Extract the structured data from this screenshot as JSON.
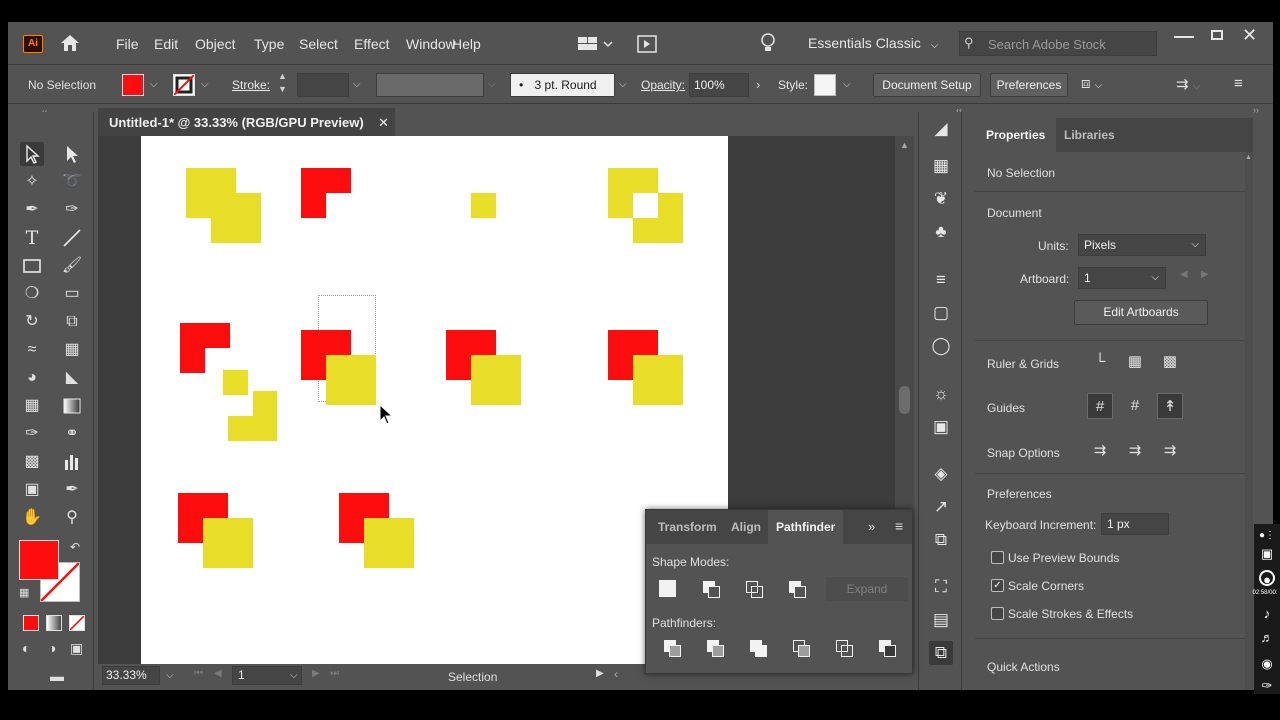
{
  "menu": {
    "logo": "Ai",
    "items": [
      "File",
      "Edit",
      "Object",
      "Type",
      "Select",
      "Effect",
      "Window",
      "Help"
    ],
    "workspace": "Essentials Classic",
    "search_placeholder": "Search Adobe Stock"
  },
  "control": {
    "selection_label": "No Selection",
    "fill_color": "#fd0d0d",
    "stroke_label": "Stroke:",
    "brush_label": "3 pt. Round",
    "opacity_label": "Opacity:",
    "opacity_value": "100%",
    "style_label": "Style:",
    "document_setup": "Document Setup",
    "preferences": "Preferences"
  },
  "document": {
    "tab_title": "Untitled-1* @ 33.33% (RGB/GPU Preview)",
    "zoom": "33.33%",
    "artboard_num": "1",
    "status_tool": "Selection"
  },
  "shape_colors": {
    "red": "#fd0d0d",
    "yellow": "#e9de27"
  },
  "pathfinder": {
    "tabs": [
      "Transform",
      "Align",
      "Pathfinder"
    ],
    "active_tab": "Pathfinder",
    "shape_modes_label": "Shape Modes:",
    "expand_label": "Expand",
    "pathfinders_label": "Pathfinders:"
  },
  "properties": {
    "tabs": [
      "Properties",
      "Libraries"
    ],
    "active_tab": "Properties",
    "no_selection": "No Selection",
    "document_label": "Document",
    "units_label": "Units:",
    "units_value": "Pixels",
    "artboard_label": "Artboard:",
    "artboard_value": "1",
    "edit_artboards": "Edit Artboards",
    "ruler_grids": "Ruler & Grids",
    "guides": "Guides",
    "snap_options": "Snap Options",
    "preferences_label": "Preferences",
    "keyboard_increment_label": "Keyboard Increment:",
    "keyboard_increment_value": "1 px",
    "use_preview_bounds": "Use Preview Bounds",
    "use_preview_bounds_checked": false,
    "scale_corners": "Scale Corners",
    "scale_corners_checked": true,
    "scale_strokes": "Scale Strokes & Effects",
    "scale_strokes_checked": false,
    "quick_actions": "Quick Actions"
  },
  "recorder": {
    "timer": "02:58/00:"
  }
}
